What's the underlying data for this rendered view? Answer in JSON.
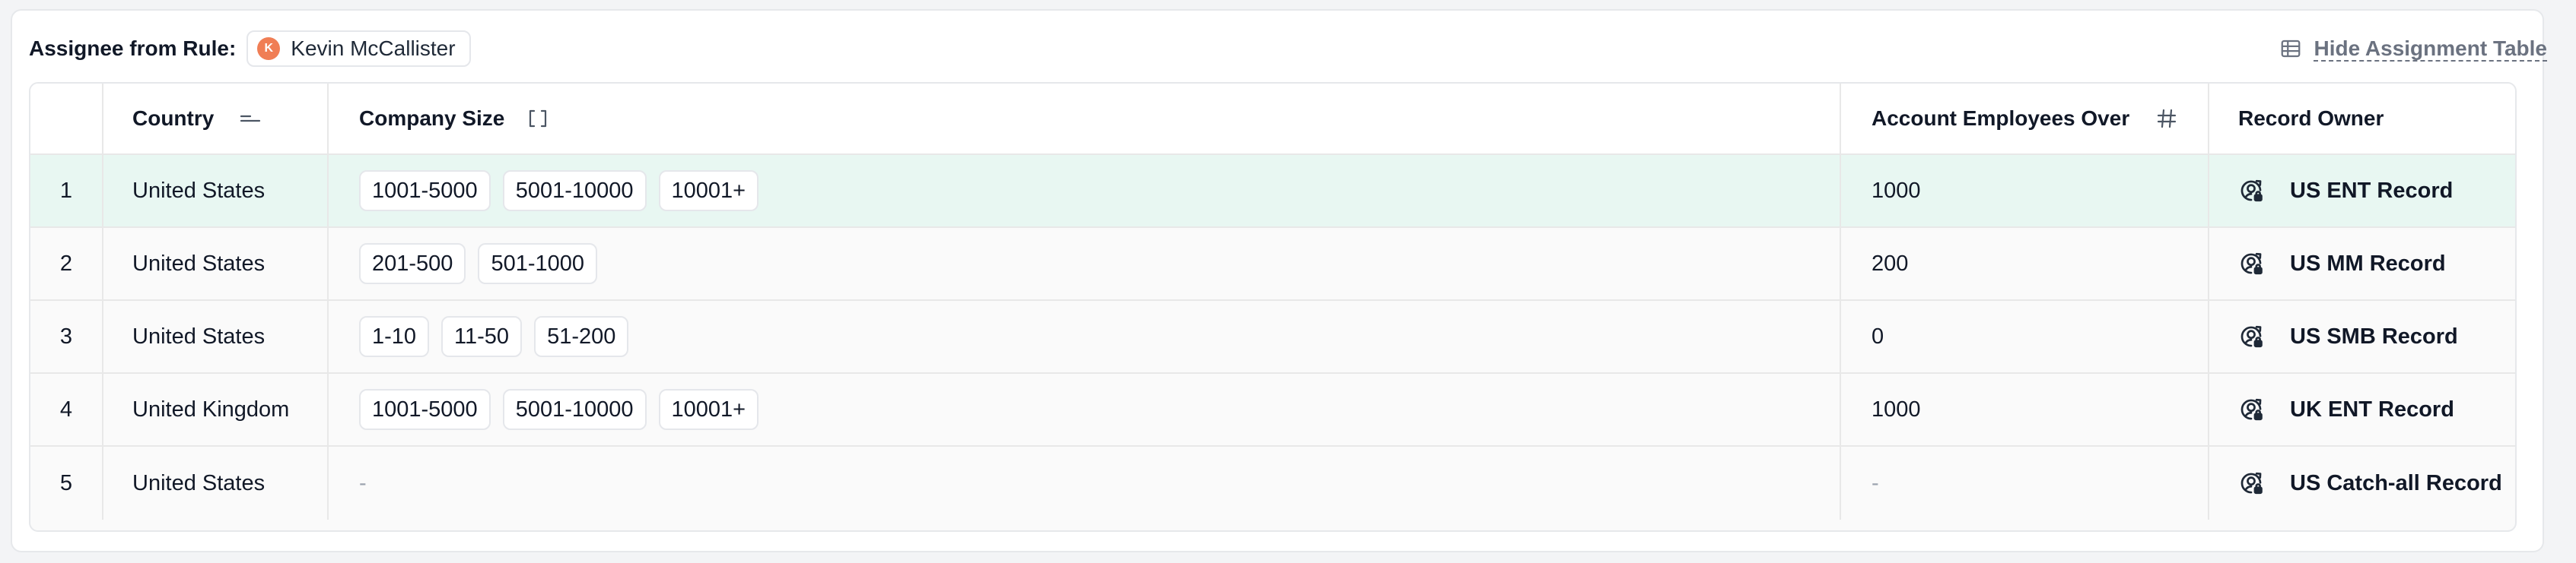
{
  "header": {
    "assignee_label": "Assignee from Rule:",
    "assignee_initial": "K",
    "assignee_name": "Kevin McCallister",
    "hide_table_label": "Hide Assignment Table"
  },
  "colors": {
    "avatar": "#f07e55",
    "highlight_row": "#e8f7f2"
  },
  "table": {
    "columns": [
      {
        "label": "",
        "icon": null
      },
      {
        "label": "Country",
        "icon": "sort-lines-icon"
      },
      {
        "label": "Company Size",
        "icon": "brackets-icon"
      },
      {
        "label": "Account Employees Over",
        "icon": "hash-icon"
      },
      {
        "label": "Record Owner",
        "icon": null
      }
    ],
    "rows": [
      {
        "index": "1",
        "country": "United States",
        "sizes": [
          "1001-5000",
          "5001-10000",
          "10001+"
        ],
        "employees_over": "1000",
        "owner": "US ENT Record",
        "highlighted": true
      },
      {
        "index": "2",
        "country": "United States",
        "sizes": [
          "201-500",
          "501-1000"
        ],
        "employees_over": "200",
        "owner": "US MM Record",
        "highlighted": false
      },
      {
        "index": "3",
        "country": "United States",
        "sizes": [
          "1-10",
          "11-50",
          "51-200"
        ],
        "employees_over": "0",
        "owner": "US SMB Record",
        "highlighted": false
      },
      {
        "index": "4",
        "country": "United Kingdom",
        "sizes": [
          "1001-5000",
          "5001-10000",
          "10001+"
        ],
        "employees_over": "1000",
        "owner": "UK ENT Record",
        "highlighted": false
      },
      {
        "index": "5",
        "country": "United States",
        "sizes": [],
        "sizes_empty": "-",
        "employees_over": "-",
        "owner": "US Catch-all Record",
        "highlighted": false
      }
    ]
  }
}
